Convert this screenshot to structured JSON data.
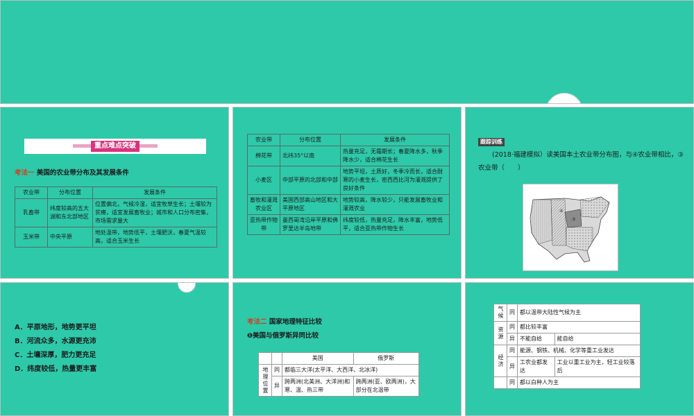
{
  "slide1": {
    "banner": "重点难点突破",
    "method_tag": "考法一",
    "method_title": "美国的农业带分布及其发展条件",
    "table": {
      "headers": [
        "农业带",
        "分布位置",
        "发展条件"
      ],
      "rows": [
        [
          "乳畜带",
          "纬度较高的五大湖和东北部地区",
          "位置偏北，气候冷湿，适宜牧草生长；土壤较为贫瘠，适宜发展畜牧业；城市和人口分布密集，市场需求量大"
        ],
        [
          "玉米带",
          "中央平原",
          "地处温带，地势低平，土壤肥沃，春夏气温较高，适合玉米生长"
        ]
      ]
    }
  },
  "slide2": {
    "table": {
      "headers": [
        "农业带",
        "分布位置",
        "发展条件"
      ],
      "rows": [
        [
          "棉花带",
          "北纬35°以南",
          "热量充足，无霜期长；春夏降水多，秋季降水少，适合棉花生长"
        ],
        [
          "小麦区",
          "中部平原的北部和中部",
          "地势平坦，土质好，冬季冷而长，适合耐寒的小麦生长，密西西比河为灌溉提供了良好条件"
        ],
        [
          "畜牧和灌溉农业区",
          "美国西部高山地区和大平原地区",
          "地势较高，降水较少，只能发展畜牧业和灌溉农业"
        ],
        [
          "亚热带作物带",
          "墨西哥湾沿岸平原和佛罗里达半岛地带",
          "纬度较低，热量充足，降水丰富，地势低平，适合亚热带作物生长"
        ]
      ]
    }
  },
  "slide3": {
    "badge": "跟踪训练",
    "question": "(2018·福建模拟）读美国本土农业带分布图，与④农业带相比，③农业带（　　）"
  },
  "slide4": {
    "options": [
      "A．平原地形，地势更平坦",
      "B．河流众多，水源更充沛",
      "C．土壤深厚，肥力更充足",
      "D．纬度较低，热量更丰富"
    ]
  },
  "slide5": {
    "method_tag": "考法二",
    "method_title": "国家地理特征比较",
    "subtitle": "❶美国与俄罗斯异同比较",
    "headers": [
      "美国",
      "俄罗斯"
    ],
    "category": "地理位置",
    "same_label": "同",
    "same_text": "都临三大洋(太平洋、大西洋、北冰洋)",
    "diff_label": "异",
    "diff_us": "跨两洲(北美洲、大洋洲)和寒、温、热三带",
    "diff_ru": "跨两洲(亚、欧两洲)，大部分在北温带"
  },
  "slide6": {
    "rows": [
      {
        "cat": "气候",
        "label": "同",
        "text": "都以温带大陆性气候为主"
      },
      {
        "cat": "资源",
        "label": "同",
        "text": "都比较丰富"
      },
      {
        "cat": "资源",
        "label": "异",
        "us": "不能自给",
        "ru": "能自给"
      },
      {
        "cat": "经济",
        "label": "同",
        "text": "能源、钢铁、机械、化学等重工业发达"
      },
      {
        "cat": "经济",
        "label": "异",
        "us": "工农业都发达",
        "ru": "工业以重工业为主，轻工业较落后"
      },
      {
        "cat": "",
        "label": "同",
        "text": "都以白种人为主"
      }
    ]
  }
}
